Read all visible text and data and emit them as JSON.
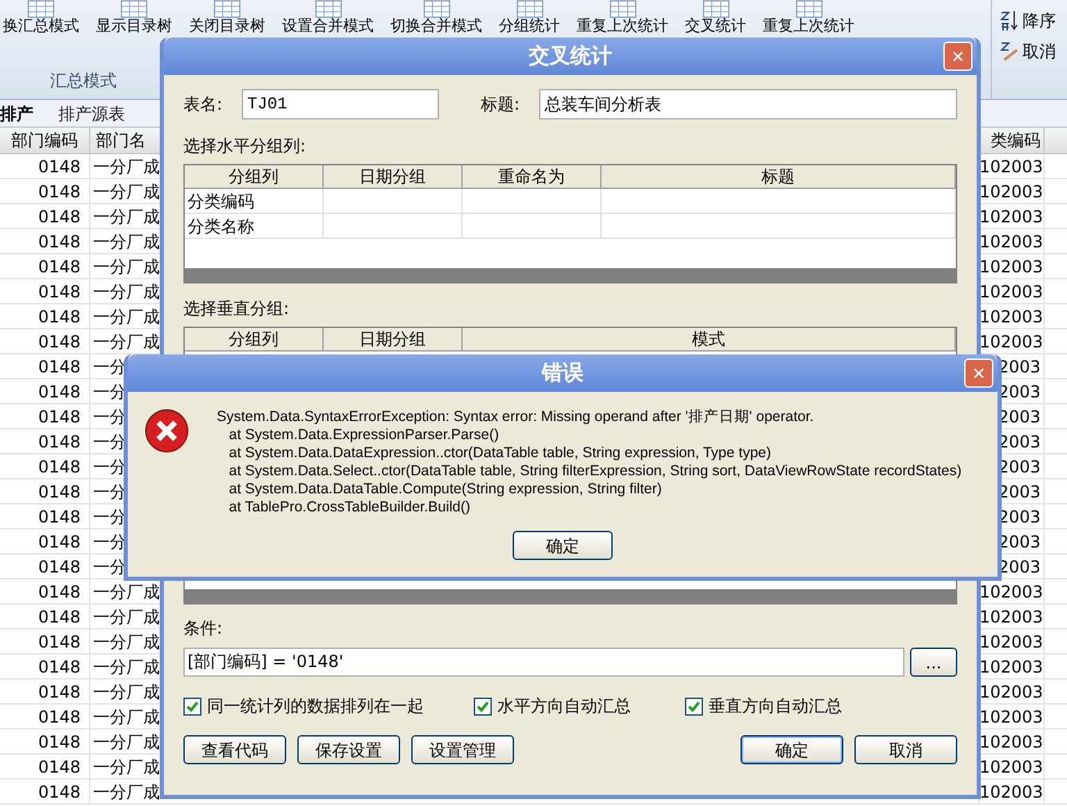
{
  "ribbon": {
    "buttons": [
      {
        "label": "换汇总模式"
      },
      {
        "label": "显示目录树"
      },
      {
        "label": "关闭目录树"
      },
      {
        "label": "设置合并模式"
      },
      {
        "label": "切换合并模式"
      },
      {
        "label": "分组统计"
      },
      {
        "label": "重复上次统计"
      },
      {
        "label": "交叉统计"
      },
      {
        "label": "重复上次统计"
      }
    ],
    "group_label": "汇总模式",
    "sort_buttons": [
      {
        "label": "降序",
        "kind": "desc"
      },
      {
        "label": "取消",
        "kind": "cancel"
      }
    ]
  },
  "sheet_tabs": [
    {
      "label": "排产",
      "selected": true
    },
    {
      "label": "排产源表",
      "selected": false
    }
  ],
  "grid": {
    "columns": [
      "部门编码",
      "部门名",
      "类编码"
    ],
    "rows": [
      {
        "dept_code": "0148",
        "dept_name": "一分厂成",
        "class_code": "102003"
      },
      {
        "dept_code": "0148",
        "dept_name": "一分厂成",
        "class_code": "102003"
      },
      {
        "dept_code": "0148",
        "dept_name": "一分厂成",
        "class_code": "102003"
      },
      {
        "dept_code": "0148",
        "dept_name": "一分厂成",
        "class_code": "102003"
      },
      {
        "dept_code": "0148",
        "dept_name": "一分厂成",
        "class_code": "102003"
      },
      {
        "dept_code": "0148",
        "dept_name": "一分厂成",
        "class_code": "102003"
      },
      {
        "dept_code": "0148",
        "dept_name": "一分厂成",
        "class_code": "102003"
      },
      {
        "dept_code": "0148",
        "dept_name": "一分厂成",
        "class_code": "102003"
      },
      {
        "dept_code": "0148",
        "dept_name": "一分",
        "class_code": "2003"
      },
      {
        "dept_code": "0148",
        "dept_name": "一分",
        "class_code": "2003"
      },
      {
        "dept_code": "0148",
        "dept_name": "一分",
        "class_code": "2003"
      },
      {
        "dept_code": "0148",
        "dept_name": "一分",
        "class_code": "2003"
      },
      {
        "dept_code": "0148",
        "dept_name": "一分",
        "class_code": "2003"
      },
      {
        "dept_code": "0148",
        "dept_name": "一分",
        "class_code": "2003"
      },
      {
        "dept_code": "0148",
        "dept_name": "一分",
        "class_code": "2003"
      },
      {
        "dept_code": "0148",
        "dept_name": "一分",
        "class_code": "2003"
      },
      {
        "dept_code": "0148",
        "dept_name": "一分",
        "class_code": "2003"
      },
      {
        "dept_code": "0148",
        "dept_name": "一分厂成",
        "class_code": "102003"
      },
      {
        "dept_code": "0148",
        "dept_name": "一分厂成",
        "class_code": "102003"
      },
      {
        "dept_code": "0148",
        "dept_name": "一分厂成",
        "class_code": "102003"
      },
      {
        "dept_code": "0148",
        "dept_name": "一分厂成",
        "class_code": "102003"
      },
      {
        "dept_code": "0148",
        "dept_name": "一分厂成",
        "class_code": "102003"
      },
      {
        "dept_code": "0148",
        "dept_name": "一分厂成",
        "class_code": "102003"
      },
      {
        "dept_code": "0148",
        "dept_name": "一分厂成",
        "class_code": "102003"
      },
      {
        "dept_code": "0148",
        "dept_name": "一分厂成",
        "class_code": "102003"
      },
      {
        "dept_code": "0148",
        "dept_name": "一分厂成",
        "class_code": "102003"
      }
    ]
  },
  "crosstab_dialog": {
    "title": "交叉统计",
    "close": "✕",
    "table_name": {
      "label": "表名:",
      "value": "TJ01"
    },
    "caption": {
      "label": "标题:",
      "value": "总装车间分析表"
    },
    "horizontal": {
      "label": "选择水平分组列:",
      "columns": [
        "分组列",
        "日期分组",
        "重命名为",
        "标题"
      ],
      "rows": [
        [
          "分类编码",
          "",
          "",
          ""
        ],
        [
          "分类名称",
          "",
          "",
          ""
        ]
      ]
    },
    "vertical": {
      "label": "选择垂直分组:",
      "columns": [
        "分组列",
        "日期分组",
        "模式"
      ]
    },
    "condition": {
      "label": "条件:",
      "value": "[部门编码] = '0148'",
      "browse": "..."
    },
    "options": [
      {
        "label": "同一统计列的数据排列在一起",
        "checked": true
      },
      {
        "label": "水平方向自动汇总",
        "checked": true
      },
      {
        "label": "垂直方向自动汇总",
        "checked": true
      }
    ],
    "left_buttons": [
      "查看代码",
      "保存设置",
      "设置管理"
    ],
    "ok": "确定",
    "cancel": "取消"
  },
  "error_dialog": {
    "title": "错误",
    "close": "✕",
    "message_lines": [
      "System.Data.SyntaxErrorException: Syntax error: Missing operand after '排产日期' operator.",
      "   at System.Data.ExpressionParser.Parse()",
      "   at System.Data.DataExpression..ctor(DataTable table, String expression, Type type)",
      "   at System.Data.Select..ctor(DataTable table, String filterExpression, String sort, DataViewRowState recordStates)",
      "   at System.Data.DataTable.Compute(String expression, String filter)",
      "   at TablePro.CrossTableBuilder.Build()"
    ],
    "ok": "确定"
  }
}
